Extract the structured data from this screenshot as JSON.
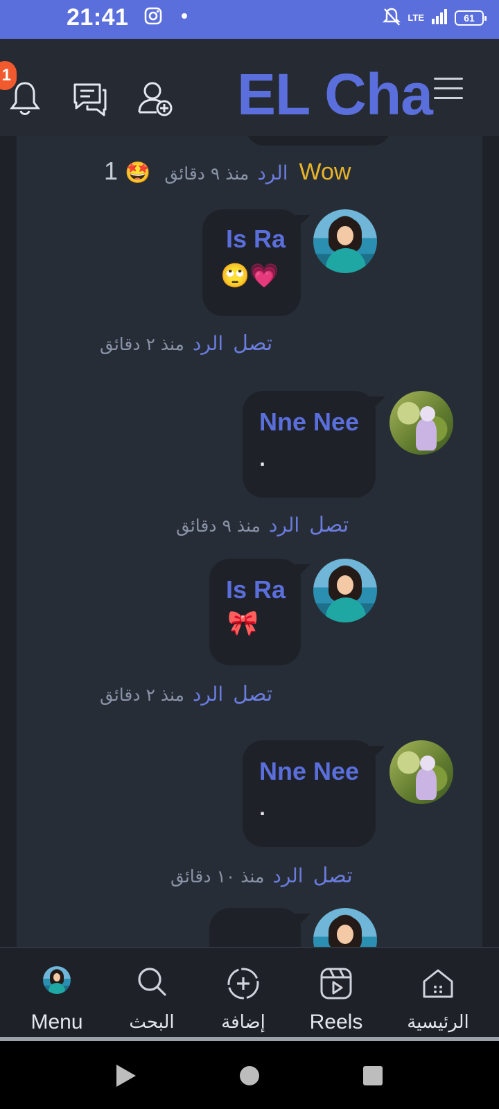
{
  "status_bar": {
    "time": "21:41",
    "battery": "61",
    "network": "LTE"
  },
  "header": {
    "notification_count": "1",
    "brand": "EL Cha",
    "icons": [
      "bell-icon",
      "chat-icon",
      "add-user-icon",
      "hamburger-menu-icon"
    ]
  },
  "thread": {
    "top_reaction": {
      "count": "1",
      "reaction_emoji": "🤩",
      "time": "منذ ٩ دقائق",
      "reply": "الرد",
      "text": "Wow"
    },
    "comments": [
      {
        "author": "Is Ra",
        "text": "🙄💗",
        "time": "منذ ٢ دقائق",
        "reply": "الرد",
        "connect": "تصل",
        "avatar": "isra"
      },
      {
        "author": "Nne Nee",
        "text": ".",
        "time": "منذ ٩ دقائق",
        "reply": "الرد",
        "connect": "تصل",
        "avatar": "nne"
      },
      {
        "author": "Is Ra",
        "text": "🎀",
        "time": "منذ ٢ دقائق",
        "reply": "الرد",
        "connect": "تصل",
        "avatar": "isra"
      },
      {
        "author": "Nne Nee",
        "text": ".",
        "time": "منذ ١٠ دقائق",
        "reply": "الرد",
        "connect": "تصل",
        "avatar": "nne"
      }
    ]
  },
  "bottom_nav": {
    "items": [
      {
        "label": "Menu",
        "icon": "profile-avatar-icon"
      },
      {
        "label": "البحث",
        "icon": "search-icon"
      },
      {
        "label": "إضافة",
        "icon": "add-circle-icon"
      },
      {
        "label": "Reels",
        "icon": "reels-icon"
      },
      {
        "label": "الرئيسية",
        "icon": "home-icon"
      }
    ]
  },
  "colors": {
    "accent": "#5b6fdc",
    "status_bar": "#5b6fdc",
    "badge": "#f15a2e",
    "wow": "#e8b52a",
    "background": "#272d36"
  }
}
